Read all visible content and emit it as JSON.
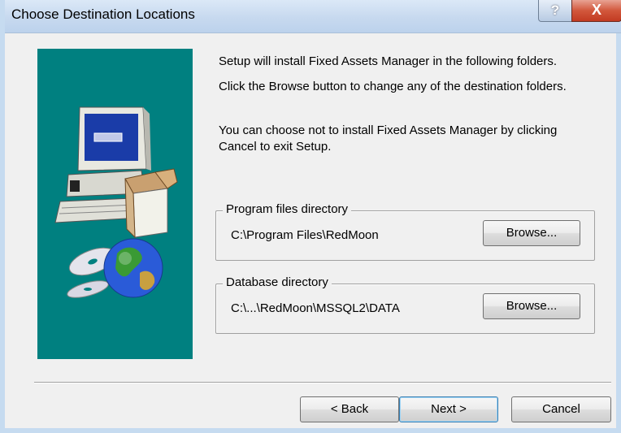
{
  "window": {
    "title": "Choose Destination Locations"
  },
  "titlebar": {
    "help_glyph": "?",
    "close_glyph": "X"
  },
  "content": {
    "line1": "Setup will install Fixed Assets Manager in the following folders.",
    "line2": "Click the Browse button to change any of the destination folders.",
    "line3": "You can choose not to install Fixed Assets Manager by clicking",
    "line4": "Cancel to exit Setup."
  },
  "program_group": {
    "label": "Program  files directory",
    "path": "C:\\Program Files\\RedMoon",
    "browse_label": "Browse..."
  },
  "database_group": {
    "label": "Database directory",
    "path": "C:\\...\\RedMoon\\MSSQL2\\DATA",
    "browse_label": "Browse..."
  },
  "buttons": {
    "back": "< Back",
    "next": "Next >",
    "cancel": "Cancel"
  },
  "side_panel": {
    "icons": [
      "computer-icon",
      "open-box-icon",
      "cd-icon",
      "globe-icon"
    ],
    "bg_color": "#008080"
  }
}
